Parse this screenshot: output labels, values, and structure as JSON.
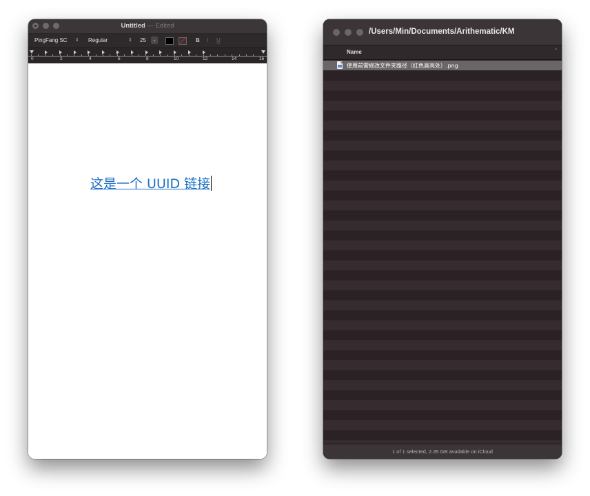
{
  "textedit": {
    "title": "Untitled",
    "title_sep": "—",
    "title_state": "Edited",
    "toolbar": {
      "font_family": "PingFang SC",
      "font_style": "Regular",
      "font_size": "25",
      "bold_label": "B",
      "italic_label": "I",
      "underline_label": "U",
      "text_color": "#000000"
    },
    "ruler": {
      "numbers": [
        "0",
        "2",
        "4",
        "6",
        "8",
        "10",
        "12",
        "14",
        "16"
      ]
    },
    "document": {
      "link_text": "这是一个 UUID 链接",
      "link_color": "#1c6fc6"
    }
  },
  "finder": {
    "path": "/Users/Min/Documents/Arithematic/KM",
    "column_name": "Name",
    "sort_indicator": "^",
    "files": [
      {
        "name": "使用前需修改文件夹路径（红色高亮处）.png",
        "selected": true,
        "icon": "png-file-icon"
      }
    ],
    "status": "1 of 1 selected, 2.35 GB available on iCloud"
  }
}
